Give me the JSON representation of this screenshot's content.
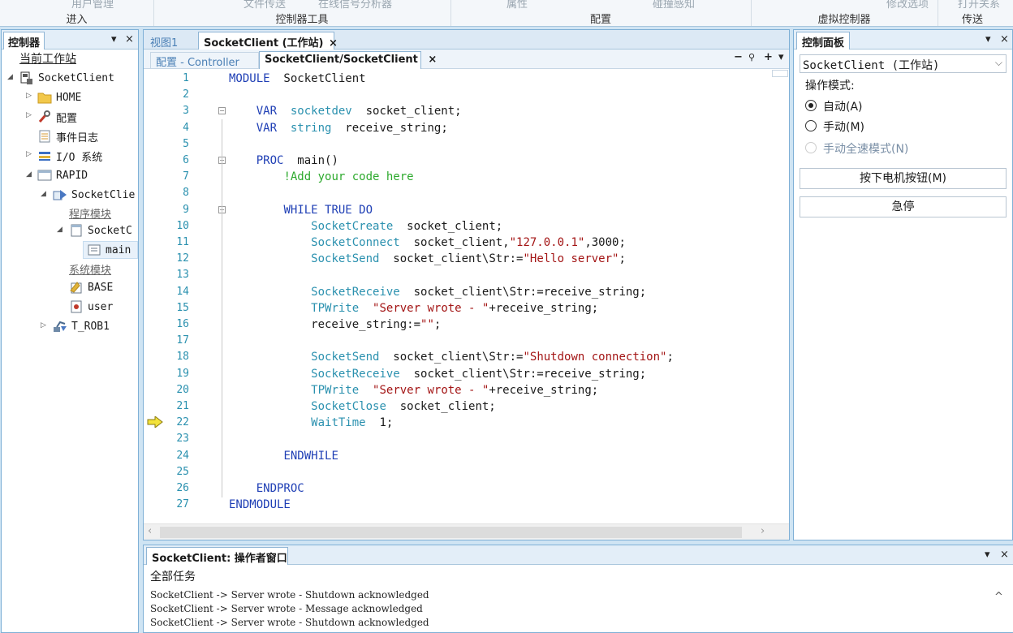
{
  "ribbon": {
    "cut_items": [
      "用户管理",
      "文件传送",
      "在线信号分析器",
      "属性",
      "碰撞感知",
      "修改选项",
      "打开关系"
    ],
    "groups": [
      "进入",
      "控制器工具",
      "配置",
      "虚拟控制器",
      "传送"
    ]
  },
  "left_panel": {
    "title": "控制器",
    "pin": "▾",
    "close": "×",
    "tree": {
      "current_station": "当前工作站",
      "controller": "SocketClient",
      "home": "HOME",
      "config": "配置",
      "event_log": "事件日志",
      "io": "I/O 系统",
      "rapid": "RAPID",
      "task": "SocketClie",
      "program_modules": "程序模块",
      "module": "SocketC",
      "routine": "main",
      "system_modules": "系统模块",
      "base": "BASE",
      "user": "user",
      "robot": "T_ROB1"
    }
  },
  "center": {
    "tabs": [
      "视图1",
      "SocketClient (工作站)"
    ],
    "tab_close": "×",
    "subtabs": [
      "配置 - Controller",
      "SocketClient/SocketClient"
    ],
    "subtab_close": "×",
    "editor_tools": [
      "−",
      "🔍",
      "+",
      "▾"
    ],
    "code": [
      {
        "n": "1",
        "parts": [
          [
            "kw",
            "MODULE"
          ],
          [
            "",
            "  SocketClient"
          ]
        ]
      },
      {
        "n": "2",
        "parts": []
      },
      {
        "n": "3",
        "parts": [
          [
            "",
            "    "
          ],
          [
            "kw",
            "VAR"
          ],
          [
            "",
            "  "
          ],
          [
            "ty",
            "socketdev"
          ],
          [
            "",
            "  socket_client;"
          ]
        ]
      },
      {
        "n": "4",
        "parts": [
          [
            "",
            "    "
          ],
          [
            "kw",
            "VAR"
          ],
          [
            "",
            "  "
          ],
          [
            "ty",
            "string"
          ],
          [
            "",
            "  receive_string;"
          ]
        ]
      },
      {
        "n": "5",
        "parts": []
      },
      {
        "n": "6",
        "parts": [
          [
            "",
            "    "
          ],
          [
            "kw",
            "PROC"
          ],
          [
            "",
            "  main()"
          ]
        ]
      },
      {
        "n": "7",
        "parts": [
          [
            "",
            "        "
          ],
          [
            "cm",
            "!Add your code here"
          ]
        ]
      },
      {
        "n": "8",
        "parts": []
      },
      {
        "n": "9",
        "parts": [
          [
            "",
            "        "
          ],
          [
            "kw",
            "WHILE TRUE DO"
          ]
        ]
      },
      {
        "n": "10",
        "parts": [
          [
            "",
            "            "
          ],
          [
            "fn",
            "SocketCreate"
          ],
          [
            "",
            "  socket_client;"
          ]
        ]
      },
      {
        "n": "11",
        "parts": [
          [
            "",
            "            "
          ],
          [
            "fn",
            "SocketConnect"
          ],
          [
            "",
            "  socket_client,"
          ],
          [
            "str",
            "\"127.0.0.1\""
          ],
          [
            "",
            ",3000;"
          ]
        ]
      },
      {
        "n": "12",
        "parts": [
          [
            "",
            "            "
          ],
          [
            "fn",
            "SocketSend"
          ],
          [
            "",
            "  socket_client\\Str:="
          ],
          [
            "str",
            "\"Hello server\""
          ],
          [
            "",
            ";"
          ]
        ]
      },
      {
        "n": "13",
        "parts": []
      },
      {
        "n": "14",
        "parts": [
          [
            "",
            "            "
          ],
          [
            "fn",
            "SocketReceive"
          ],
          [
            "",
            "  socket_client\\Str:=receive_string;"
          ]
        ]
      },
      {
        "n": "15",
        "parts": [
          [
            "",
            "            "
          ],
          [
            "fn",
            "TPWrite"
          ],
          [
            "",
            "  "
          ],
          [
            "str",
            "\"Server wrote - \""
          ],
          [
            "",
            "+receive_string;"
          ]
        ]
      },
      {
        "n": "16",
        "parts": [
          [
            "",
            "            receive_string:="
          ],
          [
            "str",
            "\"\""
          ],
          [
            "",
            ";"
          ]
        ]
      },
      {
        "n": "17",
        "parts": []
      },
      {
        "n": "18",
        "parts": [
          [
            "",
            "            "
          ],
          [
            "fn",
            "SocketSend"
          ],
          [
            "",
            "  socket_client\\Str:="
          ],
          [
            "str",
            "\"Shutdown connection\""
          ],
          [
            "",
            ";"
          ]
        ]
      },
      {
        "n": "19",
        "parts": [
          [
            "",
            "            "
          ],
          [
            "fn",
            "SocketReceive"
          ],
          [
            "",
            "  socket_client\\Str:=receive_string;"
          ]
        ]
      },
      {
        "n": "20",
        "parts": [
          [
            "",
            "            "
          ],
          [
            "fn",
            "TPWrite"
          ],
          [
            "",
            "  "
          ],
          [
            "str",
            "\"Server wrote - \""
          ],
          [
            "",
            "+receive_string;"
          ]
        ]
      },
      {
        "n": "21",
        "parts": [
          [
            "",
            "            "
          ],
          [
            "fn",
            "SocketClose"
          ],
          [
            "",
            "  socket_client;"
          ]
        ]
      },
      {
        "n": "22",
        "parts": [
          [
            "",
            "            "
          ],
          [
            "fn",
            "WaitTime"
          ],
          [
            "",
            "  1;"
          ]
        ]
      },
      {
        "n": "23",
        "parts": []
      },
      {
        "n": "24",
        "parts": [
          [
            "",
            "        "
          ],
          [
            "kw",
            "ENDWHILE"
          ]
        ]
      },
      {
        "n": "25",
        "parts": []
      },
      {
        "n": "26",
        "parts": [
          [
            "",
            "    "
          ],
          [
            "kw",
            "ENDPROC"
          ]
        ]
      },
      {
        "n": "27",
        "parts": [
          [
            "kw",
            "ENDMODULE"
          ]
        ]
      }
    ],
    "pointer_line": "22",
    "colors": {
      "keyword": "#1f3fb5",
      "type": "#2b91af",
      "string": "#a31515",
      "comment": "#2eaa2e"
    }
  },
  "right_panel": {
    "title": "控制面板",
    "pin": "▾",
    "close": "×",
    "controller_select": "SocketClient (工作站)",
    "mode_label": "操作模式:",
    "modes": [
      "自动(A)",
      "手动(M)",
      "手动全速模式(N)"
    ],
    "selected_mode": 0,
    "motor_button": "按下电机按钮(M)",
    "estop_button": "急停"
  },
  "output": {
    "title": "SocketClient: 操作者窗口",
    "pin": "▾",
    "close": "×",
    "filter": "全部任务",
    "lines": [
      "SocketClient -> Server wrote - Shutdown acknowledged",
      "SocketClient -> Server wrote - Message acknowledged",
      "SocketClient -> Server wrote - Shutdown acknowledged"
    ],
    "scroll_up": "^"
  }
}
